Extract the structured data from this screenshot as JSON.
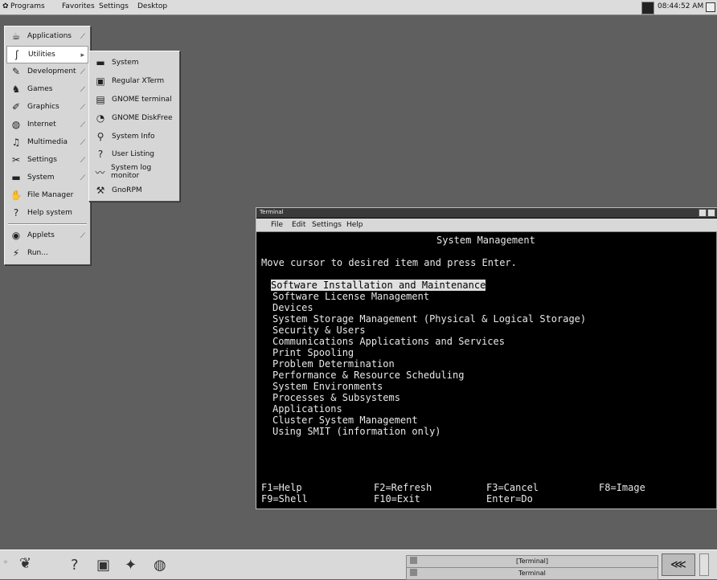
{
  "top_menubar": {
    "items": [
      "Programs",
      "Favorites",
      "Settings",
      "Desktop"
    ],
    "clock": "08:44:52 AM"
  },
  "programs_menu": {
    "items": [
      {
        "label": "Applications",
        "icon": "applications-icon",
        "submenu": true
      },
      {
        "label": "Utilities",
        "icon": "utilities-icon",
        "submenu": true,
        "selected": true
      },
      {
        "label": "Development",
        "icon": "development-icon",
        "submenu": true
      },
      {
        "label": "Games",
        "icon": "games-icon",
        "submenu": true
      },
      {
        "label": "Graphics",
        "icon": "graphics-icon",
        "submenu": true
      },
      {
        "label": "Internet",
        "icon": "internet-icon",
        "submenu": true
      },
      {
        "label": "Multimedia",
        "icon": "multimedia-icon",
        "submenu": true
      },
      {
        "label": "Settings",
        "icon": "settings-icon",
        "submenu": true
      },
      {
        "label": "System",
        "icon": "system-icon",
        "submenu": true
      },
      {
        "label": "File Manager",
        "icon": "file-manager-icon",
        "submenu": false
      },
      {
        "label": "Help system",
        "icon": "help-icon",
        "submenu": false
      },
      {
        "label": "Applets",
        "icon": "applets-icon",
        "submenu": true
      },
      {
        "label": "Run...",
        "icon": "run-icon",
        "submenu": false
      }
    ]
  },
  "utilities_menu": {
    "items": [
      {
        "label": "System",
        "icon": "system-icon"
      },
      {
        "label": "Regular XTerm",
        "icon": "xterm-icon"
      },
      {
        "label": "GNOME terminal",
        "icon": "gnome-terminal-icon"
      },
      {
        "label": "GNOME DiskFree",
        "icon": "diskfree-icon"
      },
      {
        "label": "System Info",
        "icon": "system-info-icon"
      },
      {
        "label": "User Listing",
        "icon": "user-listing-icon"
      },
      {
        "label": "System log monitor",
        "icon": "log-monitor-icon"
      },
      {
        "label": "GnoRPM",
        "icon": "gnorpm-icon"
      }
    ]
  },
  "terminal": {
    "title": "Terminal",
    "menus": [
      "File",
      "Edit",
      "Settings",
      "Help"
    ],
    "screen_title": "System Management",
    "prompt": "Move cursor to desired item and press Enter.",
    "items": [
      "Software Installation and Maintenance",
      "Software License Management",
      "Devices",
      "System Storage Management (Physical & Logical Storage)",
      "Security & Users",
      "Communications Applications and Services",
      "Print Spooling",
      "Problem Determination",
      "Performance & Resource Scheduling",
      "System Environments",
      "Processes & Subsystems",
      "Applications",
      "Cluster System Management",
      "Using SMIT (information only)"
    ],
    "fkeys_row1": [
      "F1=Help",
      "F2=Refresh",
      "F3=Cancel",
      "F8=Image"
    ],
    "fkeys_row2": [
      "F9=Shell",
      "F10=Exit",
      "Enter=Do"
    ]
  },
  "taskbar": {
    "tasks": [
      "[Terminal]",
      "Terminal"
    ]
  }
}
